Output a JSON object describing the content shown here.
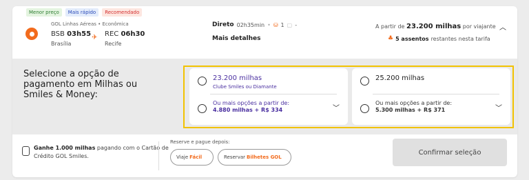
{
  "tags": [
    "Menor preço",
    "Mais rápido",
    "Recomendado"
  ],
  "flight": {
    "airline": "GOL Linhas Aéreas • Econômica",
    "from_code": "BSB",
    "from_time": "03h55",
    "from_city": "Brasília",
    "to_code": "REC",
    "to_time": "06h30",
    "to_city": "Recife",
    "plane_icon": "plane-icon"
  },
  "route": {
    "type": "Direto",
    "duration": "02h35min",
    "sep": "•",
    "bag_count": "1",
    "bag2_text": "-",
    "details": "Mais detalhes"
  },
  "price": {
    "prefix": "A partir de",
    "miles": "23.200 milhas",
    "suffix": "por viajante",
    "seats_count": "5 assentos",
    "seats_suffix": "restantes nesta tarifa"
  },
  "payment": {
    "title": "Selecione a opção de pagamento em Milhas ou Smiles & Money:",
    "option1": {
      "miles": "23.200 milhas",
      "sub": "Clube Smiles ou Diamante",
      "more_label": "Ou mais opções a partir de:",
      "more_value": "4.880 milhas + R$ 334"
    },
    "option2": {
      "miles": "25.200 milhas",
      "more_label": "Ou mais opções a partir de:",
      "more_value": "5.300 milhas + R$ 371"
    }
  },
  "footer": {
    "promo_bold": "Ganhe 1.000 milhas",
    "promo_rest": "pagando com o Cartão de Crédito GOL Smiles.",
    "reserve_label": "Reserve e pague depois:",
    "pill1_prefix": "Viaje",
    "pill1_brand": "Fácil",
    "pill2_prefix": "Reservar",
    "pill2_brand": "Bilhetes GOL",
    "confirm": "Confirmar seleção"
  },
  "colors": {
    "accent": "#f26b1d",
    "purple": "#4a2fa0",
    "highlight": "#f2c200"
  }
}
